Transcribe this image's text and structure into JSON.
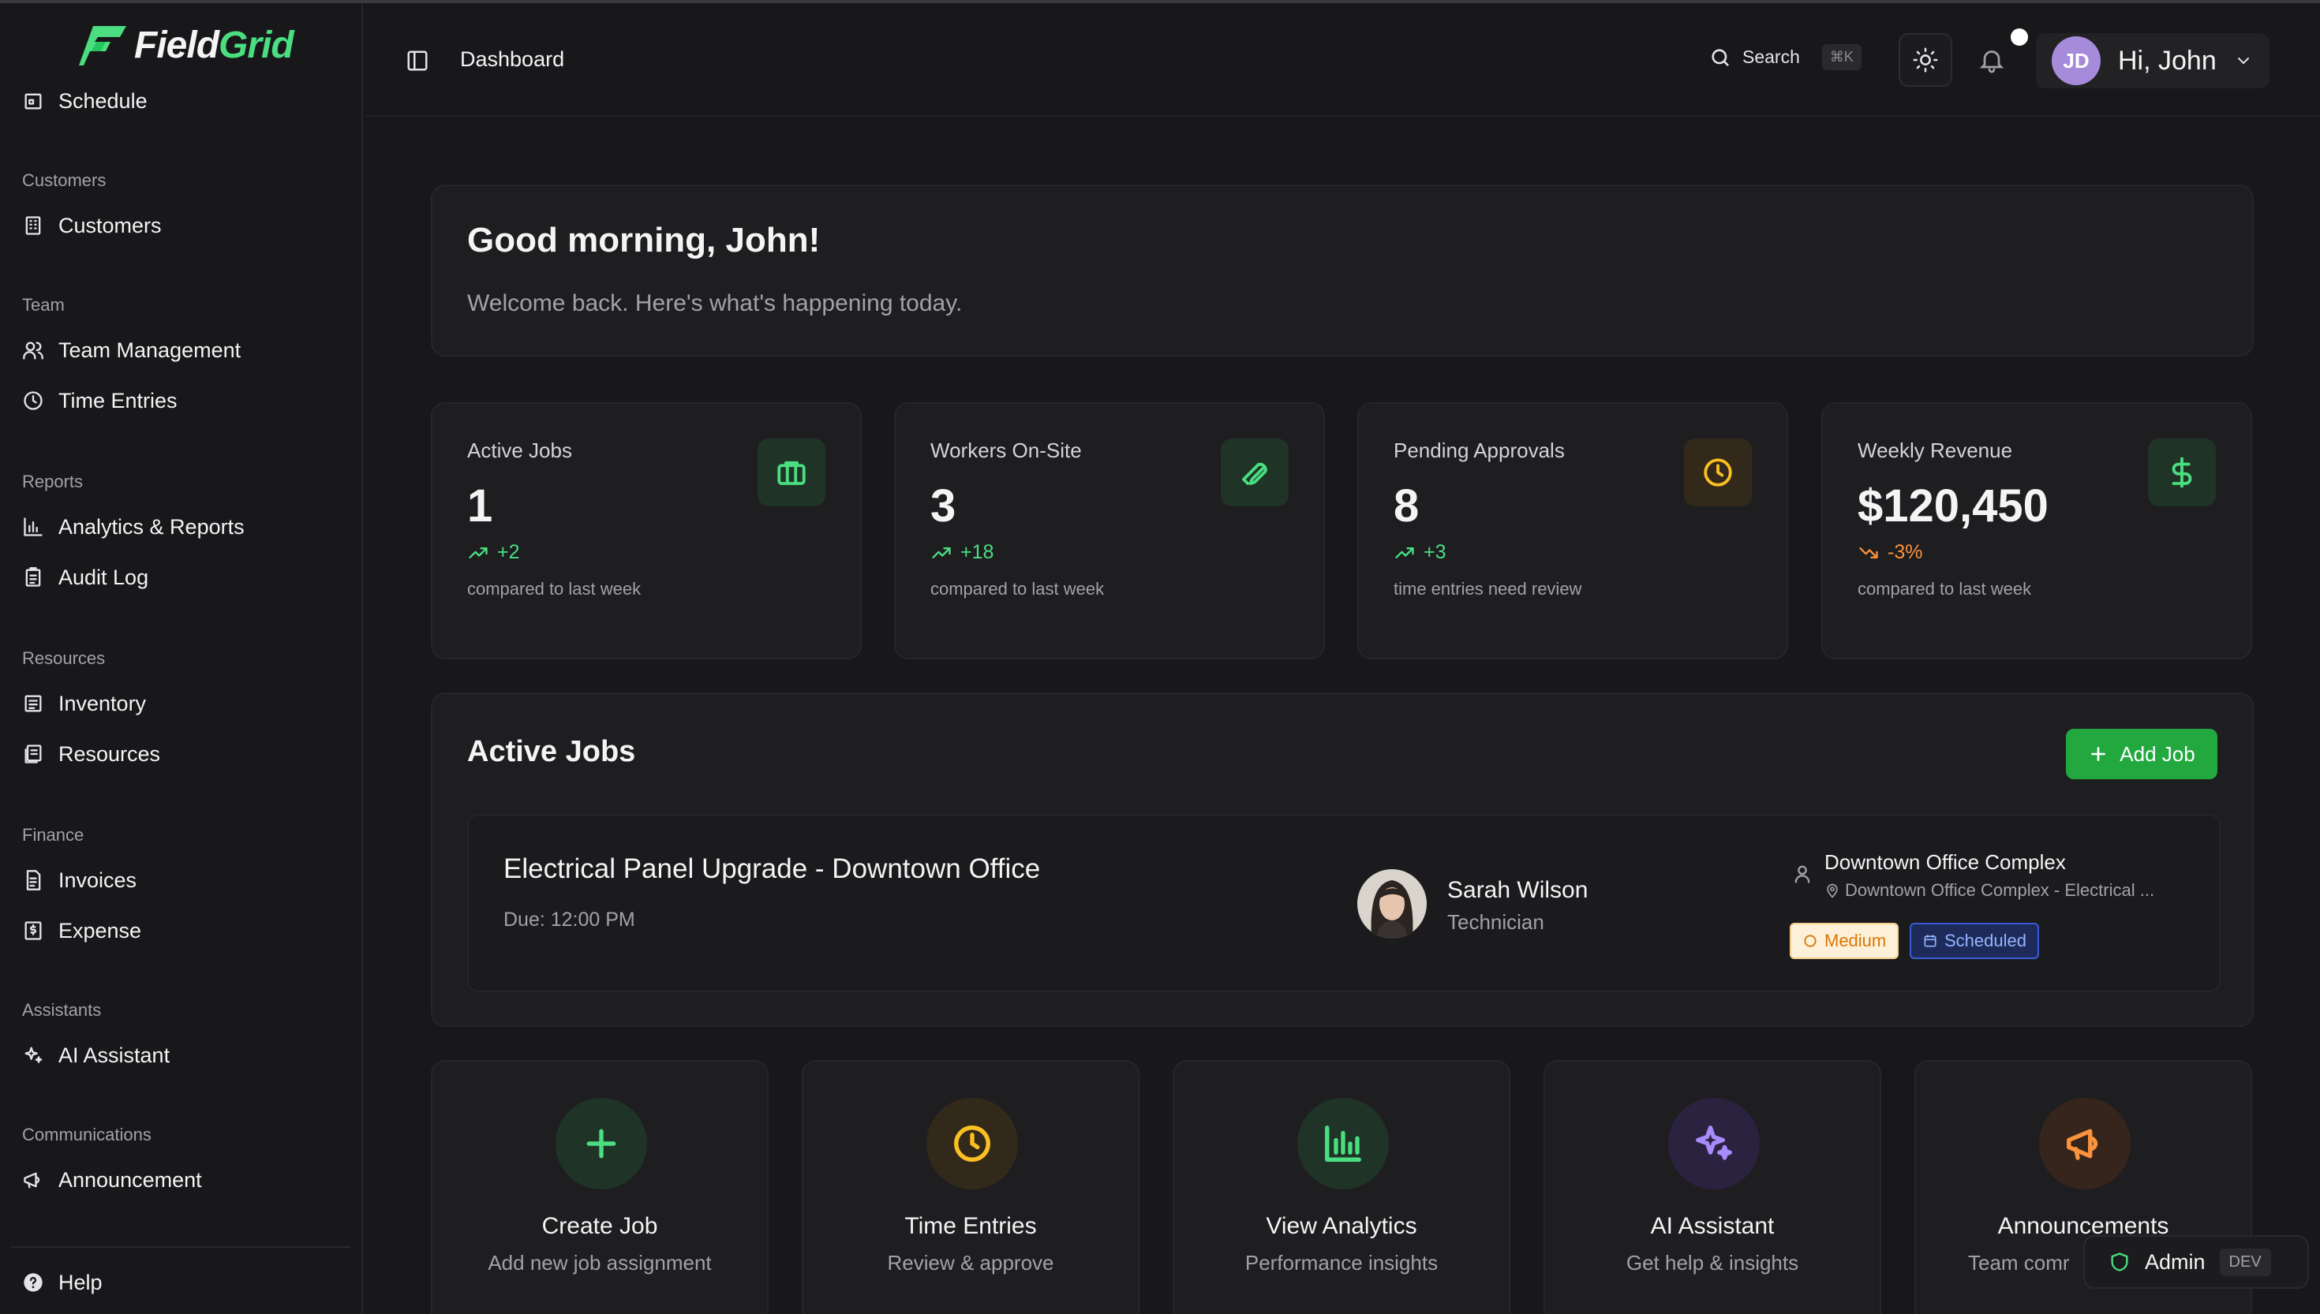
{
  "app": {
    "logo_prefix": "Field",
    "logo_suffix": "Grid"
  },
  "sidebar": {
    "partial_item": "Schedule",
    "sections": {
      "customers": "Customers",
      "team": "Team",
      "reports": "Reports",
      "resources": "Resources",
      "finance": "Finance",
      "assistants": "Assistants",
      "communications": "Communications"
    },
    "items": {
      "customers": "Customers",
      "team_management": "Team Management",
      "time_entries": "Time Entries",
      "analytics": "Analytics & Reports",
      "audit_log": "Audit Log",
      "inventory": "Inventory",
      "resources": "Resources",
      "invoices": "Invoices",
      "expense": "Expense",
      "ai_assistant": "AI Assistant",
      "announcement": "Announcement",
      "help": "Help"
    }
  },
  "header": {
    "title": "Dashboard",
    "search_label": "Search",
    "search_shortcut": "⌘K",
    "user_initials": "JD",
    "greeting": "Hi, John"
  },
  "welcome": {
    "title": "Good morning, John!",
    "subtitle": "Welcome back. Here's what's happening today."
  },
  "stats": [
    {
      "label": "Active Jobs",
      "value": "1",
      "change": "+2",
      "note": "compared to last week",
      "icon": "briefcase-icon"
    },
    {
      "label": "Workers On-Site",
      "value": "3",
      "change": "+18",
      "note": "compared to last week",
      "icon": "wrench-icon"
    },
    {
      "label": "Pending Approvals",
      "value": "8",
      "change": "+3",
      "note": "time entries need review",
      "icon": "clock-icon"
    },
    {
      "label": "Weekly Revenue",
      "value": "$120,450",
      "change": "-3%",
      "note": "compared to last week",
      "icon": "dollar-icon"
    }
  ],
  "active_jobs": {
    "title": "Active Jobs",
    "add_button": "Add Job",
    "jobs": [
      {
        "title": "Electrical Panel Upgrade - Downtown Office",
        "due": "Due: 12:00 PM",
        "assignee_name": "Sarah Wilson",
        "assignee_role": "Technician",
        "location_name": "Downtown Office Complex",
        "location_detail": "Downtown Office Complex - Electrical ...",
        "priority": "Medium",
        "status": "Scheduled"
      }
    ]
  },
  "quick_actions": [
    {
      "title": "Create Job",
      "subtitle": "Add new job assignment",
      "icon": "plus-icon"
    },
    {
      "title": "Time Entries",
      "subtitle": "Review & approve",
      "icon": "clock-icon"
    },
    {
      "title": "View Analytics",
      "subtitle": "Performance insights",
      "icon": "bar-chart-icon"
    },
    {
      "title": "AI Assistant",
      "subtitle": "Get help & insights",
      "icon": "sparkles-icon"
    },
    {
      "title": "Announcements",
      "subtitle": "Team comr",
      "icon": "megaphone-icon"
    }
  ],
  "role_pill": {
    "role": "Admin",
    "env": "DEV"
  },
  "colors": {
    "accent_green": "#4ade80",
    "button_green": "#22a83f",
    "warning_amber": "#f59e0b",
    "negative_orange": "#fb923c",
    "ai_purple": "#a78bfa"
  }
}
